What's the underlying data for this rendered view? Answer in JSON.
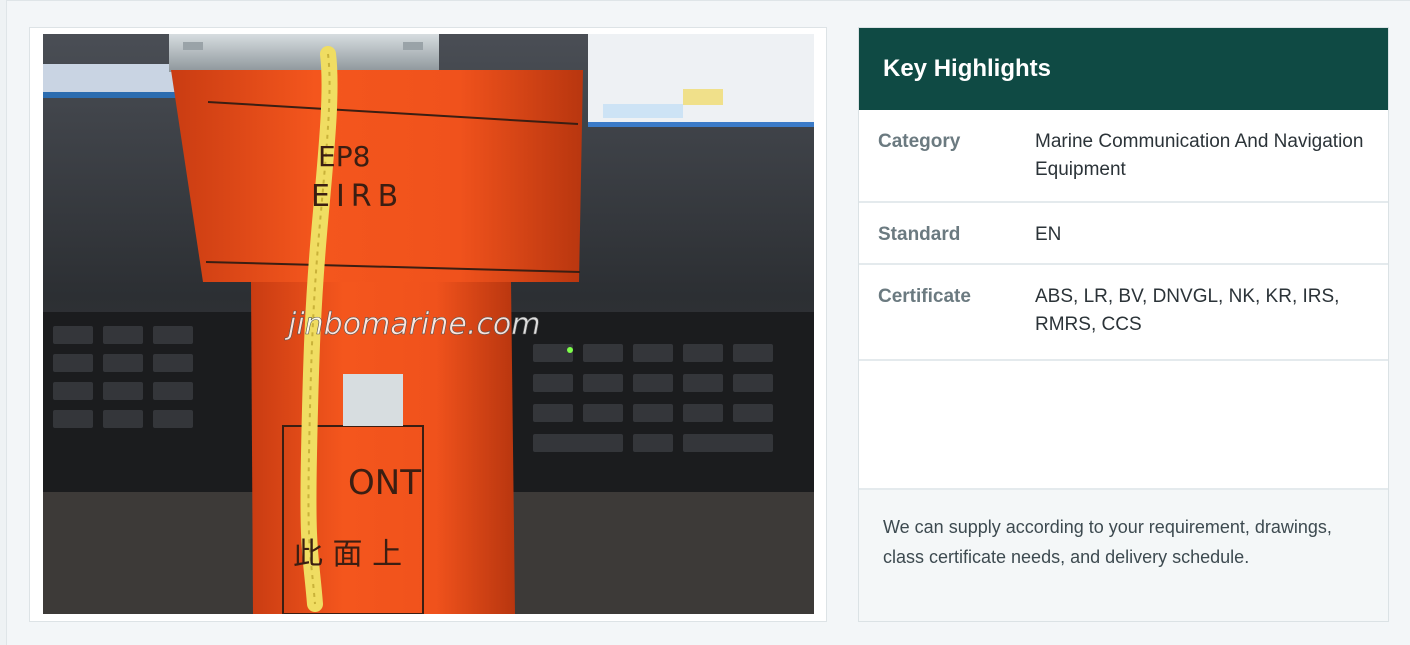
{
  "photo": {
    "alt": "EPIRB beacon",
    "watermark": "jinbomarine.com",
    "device_model": "EP8",
    "device_type": "EIRB",
    "front_label": "ONT",
    "chinese_label": "此 面 上"
  },
  "highlights": {
    "title": "Key Highlights",
    "rows": [
      {
        "label": "Category",
        "value": "Marine Communication And Navigation Equipment"
      },
      {
        "label": "Standard",
        "value": "EN"
      },
      {
        "label": "Certificate",
        "value": "ABS, LR, BV, DNVGL, NK, KR, IRS, RMRS, CCS"
      }
    ],
    "footer": "We can supply according to your requirement, drawings, class certificate needs, and delivery schedule."
  },
  "colors": {
    "header_bg": "#0f4a44",
    "device_orange": "#f0521c"
  }
}
